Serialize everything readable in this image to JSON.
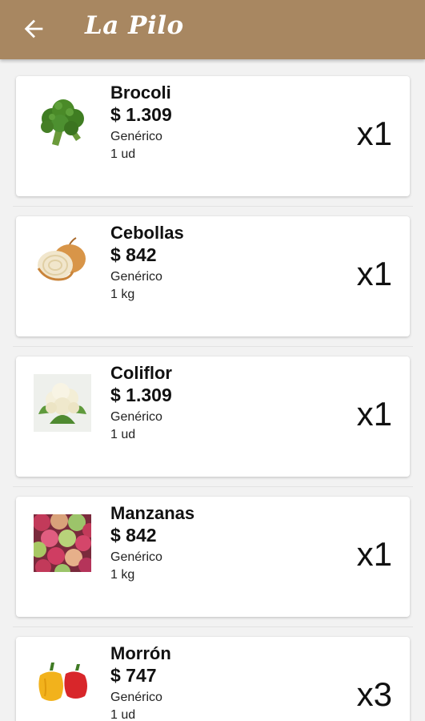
{
  "header": {
    "title": "La Pilo",
    "back_icon": "arrow-left-icon",
    "background_color": "#a88761"
  },
  "products": [
    {
      "name": "Brocoli",
      "price": "$ 1.309",
      "brand": "Genérico",
      "unit": "1 ud",
      "quantity": "x1",
      "icon": "broccoli-image"
    },
    {
      "name": "Cebollas",
      "price": "$ 842",
      "brand": "Genérico",
      "unit": "1 kg",
      "quantity": "x1",
      "icon": "onion-image"
    },
    {
      "name": "Coliflor",
      "price": "$ 1.309",
      "brand": "Genérico",
      "unit": "1 ud",
      "quantity": "x1",
      "icon": "cauliflower-image"
    },
    {
      "name": "Manzanas",
      "price": "$ 842",
      "brand": "Genérico",
      "unit": "1 kg",
      "quantity": "x1",
      "icon": "apples-image"
    },
    {
      "name": "Morrón",
      "price": "$ 747",
      "brand": "Genérico",
      "unit": "1 ud",
      "quantity": "x3",
      "icon": "bell-peppers-image"
    }
  ]
}
